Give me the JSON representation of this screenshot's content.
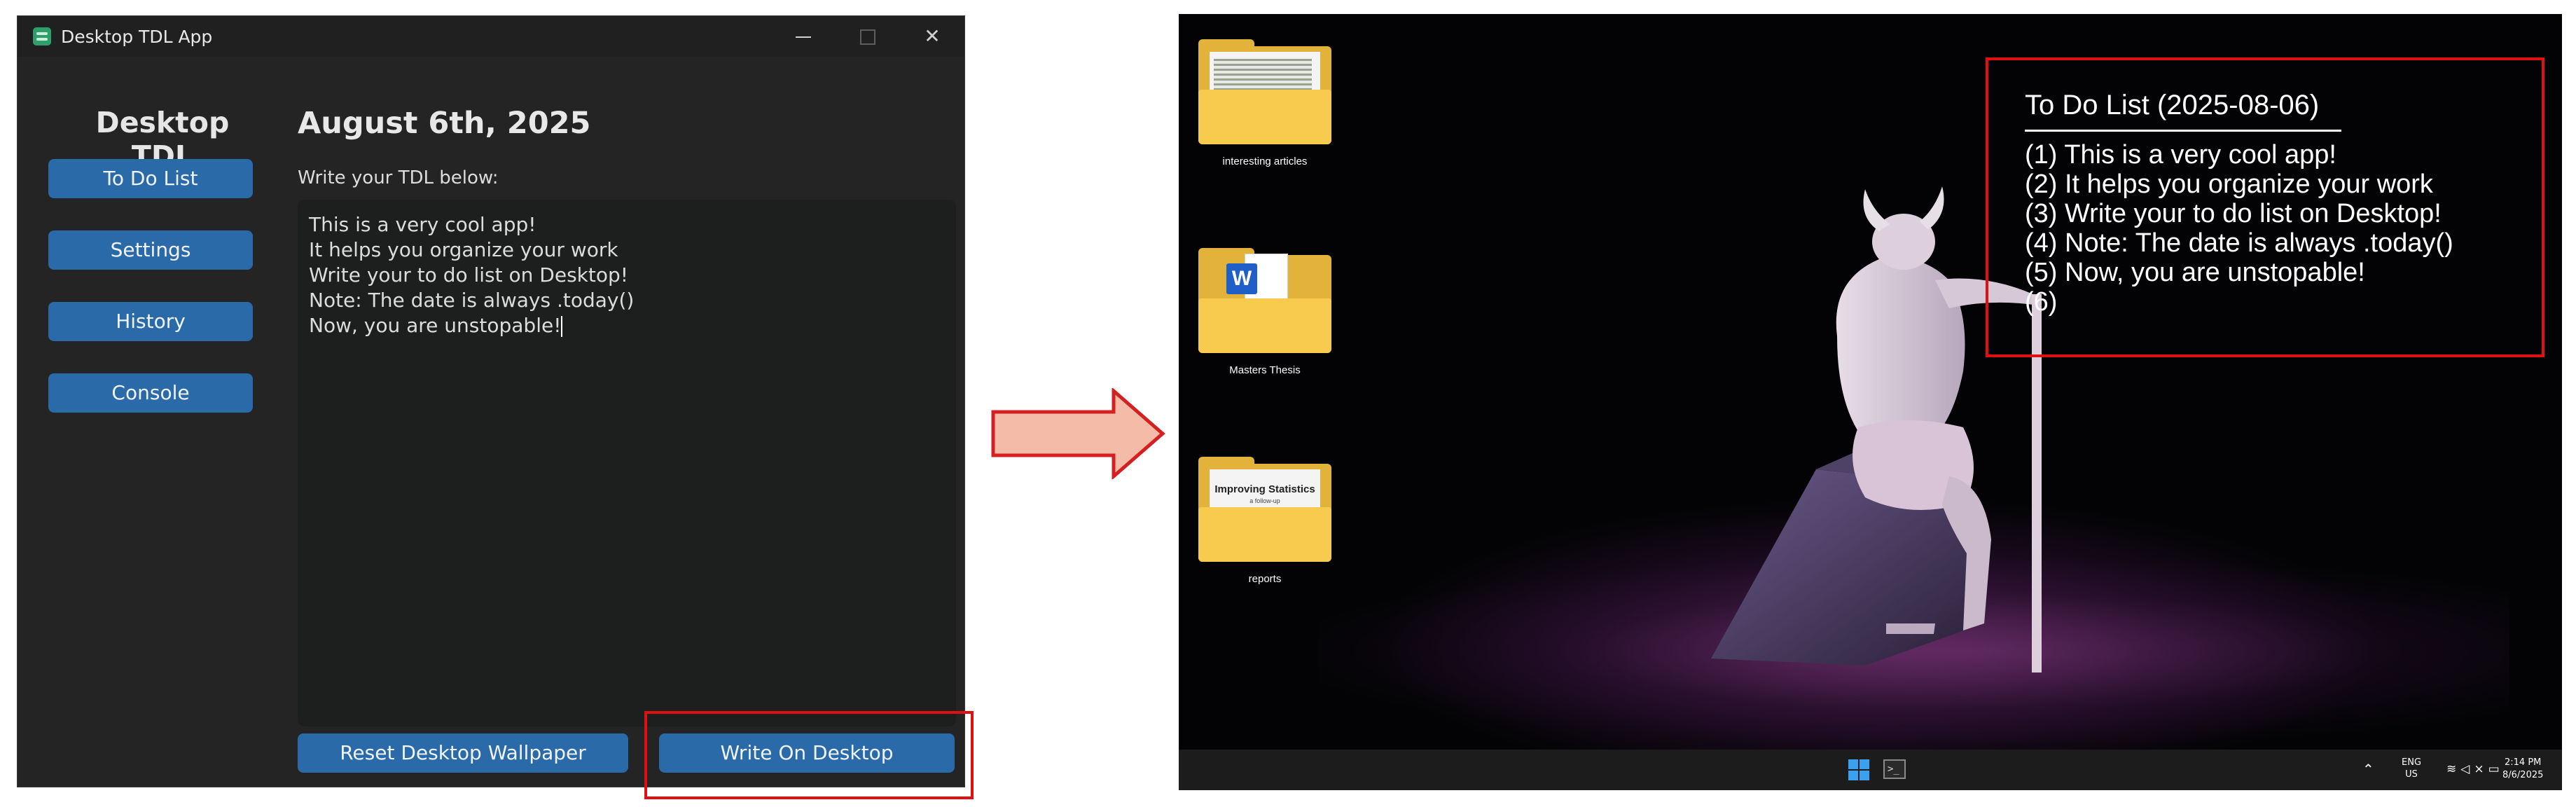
{
  "app": {
    "window_title": "Desktop TDL App",
    "sidebar_title": "Desktop TDL",
    "nav": [
      "To Do List",
      "Settings",
      "History",
      "Console"
    ],
    "date_heading": "August 6th, 2025",
    "prompt_label": "Write your TDL below:",
    "text_lines": [
      "This is a very cool app!",
      "It helps you organize your work",
      "Write your to do list on Desktop!",
      "Note: The date is always .today()",
      "Now, you are unstopable!"
    ],
    "reset_button": "Reset Desktop Wallpaper",
    "write_button": "Write On Desktop"
  },
  "desktop": {
    "icons": [
      {
        "label": "interesting articles",
        "icon": "folder-icon"
      },
      {
        "label": "Masters Thesis",
        "icon": "folder-word-icon"
      },
      {
        "label": "reports",
        "icon": "folder-icon",
        "paper_title": "Improving Statistics",
        "paper_subtitle": "a follow-up"
      }
    ],
    "overlay": {
      "title": "To Do List (2025-08-06)",
      "items": [
        "(1) This is a very cool app!",
        "(2) It helps you organize your work",
        "(3) Write your to do list on Desktop!",
        "(4) Note: The date is always .today()",
        "(5) Now, you are unstopable!",
        "(6)"
      ]
    },
    "taskbar": {
      "lang_line1": "ENG",
      "lang_line2": "US",
      "time": "2:14 PM",
      "date": "8/6/2025"
    }
  },
  "colors": {
    "button_blue": "#2a6aa8",
    "highlight_red": "#e01010",
    "arrow_fill": "#f4bca8",
    "arrow_stroke": "#d42020"
  }
}
